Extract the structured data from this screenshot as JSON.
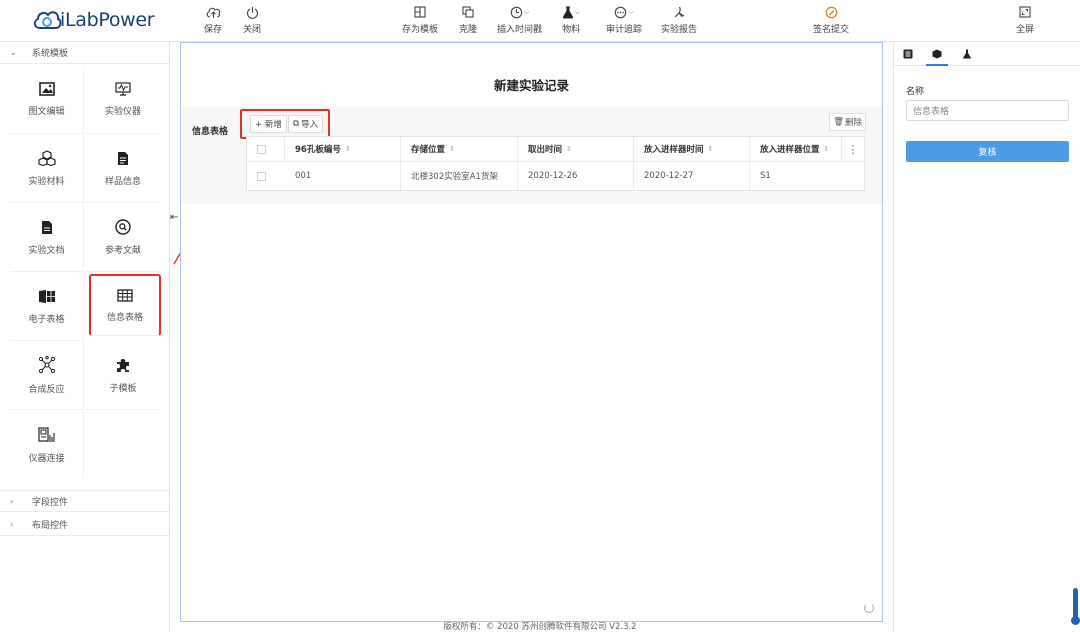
{
  "app": {
    "logo_text": "iLabPower"
  },
  "toolbar": {
    "save": "保存",
    "close": "关闭",
    "save_template": "存为模板",
    "clone": "克隆",
    "insert_timestamp": "插入时间戳",
    "materials": "物料",
    "audit_trail": "审计追踪",
    "experiment_report": "实验报告",
    "sign_submit": "签名提交",
    "fullscreen": "全屏"
  },
  "sidebar": {
    "system_templates": "系统模板",
    "items": [
      {
        "label": "图文编辑",
        "icon": "image-text-icon"
      },
      {
        "label": "实验仪器",
        "icon": "instrument-icon"
      },
      {
        "label": "实验材料",
        "icon": "cubes-icon"
      },
      {
        "label": "样品信息",
        "icon": "document-icon"
      },
      {
        "label": "实验文档",
        "icon": "file-icon"
      },
      {
        "label": "参考文献",
        "icon": "search-circle-icon"
      },
      {
        "label": "电子表格",
        "icon": "spreadsheet-icon"
      },
      {
        "label": "信息表格",
        "icon": "table-icon"
      },
      {
        "label": "合成反应",
        "icon": "molecule-icon"
      },
      {
        "label": "子模板",
        "icon": "puzzle-icon"
      },
      {
        "label": "仪器连接",
        "icon": "instrument-link-icon"
      }
    ],
    "field_controls": "字段控件",
    "layout_controls": "布局控件"
  },
  "canvas": {
    "title": "新建实验记录",
    "info_table": {
      "label": "信息表格",
      "add_button": "+ 新增",
      "import_button": "导入",
      "delete_button": "删除",
      "columns": [
        "96孔板编号",
        "存储位置",
        "取出时间",
        "放入进样器时间",
        "放入进样器位置"
      ],
      "rows": [
        [
          "001",
          "北楼302实验室A1货架",
          "2020-12-26",
          "2020-12-27",
          "S1"
        ]
      ]
    }
  },
  "footer": {
    "copyright": "版权所有：© 2020 苏州创腾软件有限公司   V2.3.2"
  },
  "right_panel": {
    "name_label": "名称",
    "name_placeholder": "信息表格",
    "review_button": "复核"
  },
  "colors": {
    "accent": "#4a9be8",
    "highlight": "#e0302c",
    "logo": "#1a3f77"
  }
}
